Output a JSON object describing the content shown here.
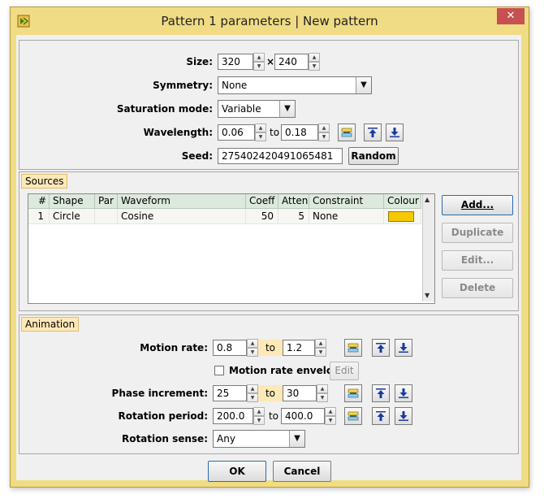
{
  "window": {
    "title": "Pattern 1 parameters | New pattern"
  },
  "params": {
    "size_label": "Size:",
    "size_w": "320",
    "size_sep": "×",
    "size_h": "240",
    "symmetry_label": "Symmetry:",
    "symmetry_value": "None",
    "saturation_label": "Saturation mode:",
    "saturation_value": "Variable",
    "wavelength_label": "Wavelength:",
    "wavelength_min": "0.06",
    "wavelength_to": "to",
    "wavelength_max": "0.18",
    "seed_label": "Seed:",
    "seed_value": "275402420491065481",
    "random_button": "Random"
  },
  "sources": {
    "title": "Sources",
    "columns": [
      "#",
      "Shape",
      "Par",
      "Waveform",
      "Coeff",
      "Atten",
      "Constraint",
      "Colour"
    ],
    "rows": [
      {
        "num": "1",
        "shape": "Circle",
        "par": "",
        "waveform": "Cosine",
        "coeff": "50",
        "atten": "5",
        "constraint": "None",
        "colour": "#f5c800"
      }
    ],
    "add_button": "Add...",
    "duplicate_button": "Duplicate",
    "edit_button": "Edit...",
    "delete_button": "Delete"
  },
  "animation": {
    "title": "Animation",
    "motion_rate_label": "Motion rate:",
    "motion_rate_min": "0.8",
    "motion_rate_to": "to",
    "motion_rate_max": "1.2",
    "envelope_label": "Motion rate envelope",
    "envelope_edit": "Edit",
    "phase_label": "Phase increment:",
    "phase_min": "25",
    "phase_to": "to",
    "phase_max": "30",
    "rotation_period_label": "Rotation period:",
    "rotation_min": "200.0",
    "rotation_to": "to",
    "rotation_max": "400.0",
    "rotation_sense_label": "Rotation sense:",
    "rotation_sense_value": "Any"
  },
  "footer": {
    "ok": "OK",
    "cancel": "Cancel"
  },
  "colors": {
    "frame": "#f0dc84",
    "tab_highlight": "#fde8b7",
    "table_header": "#dce9dc",
    "close": "#c75050",
    "arrow_icon": "#1a3aa0"
  }
}
